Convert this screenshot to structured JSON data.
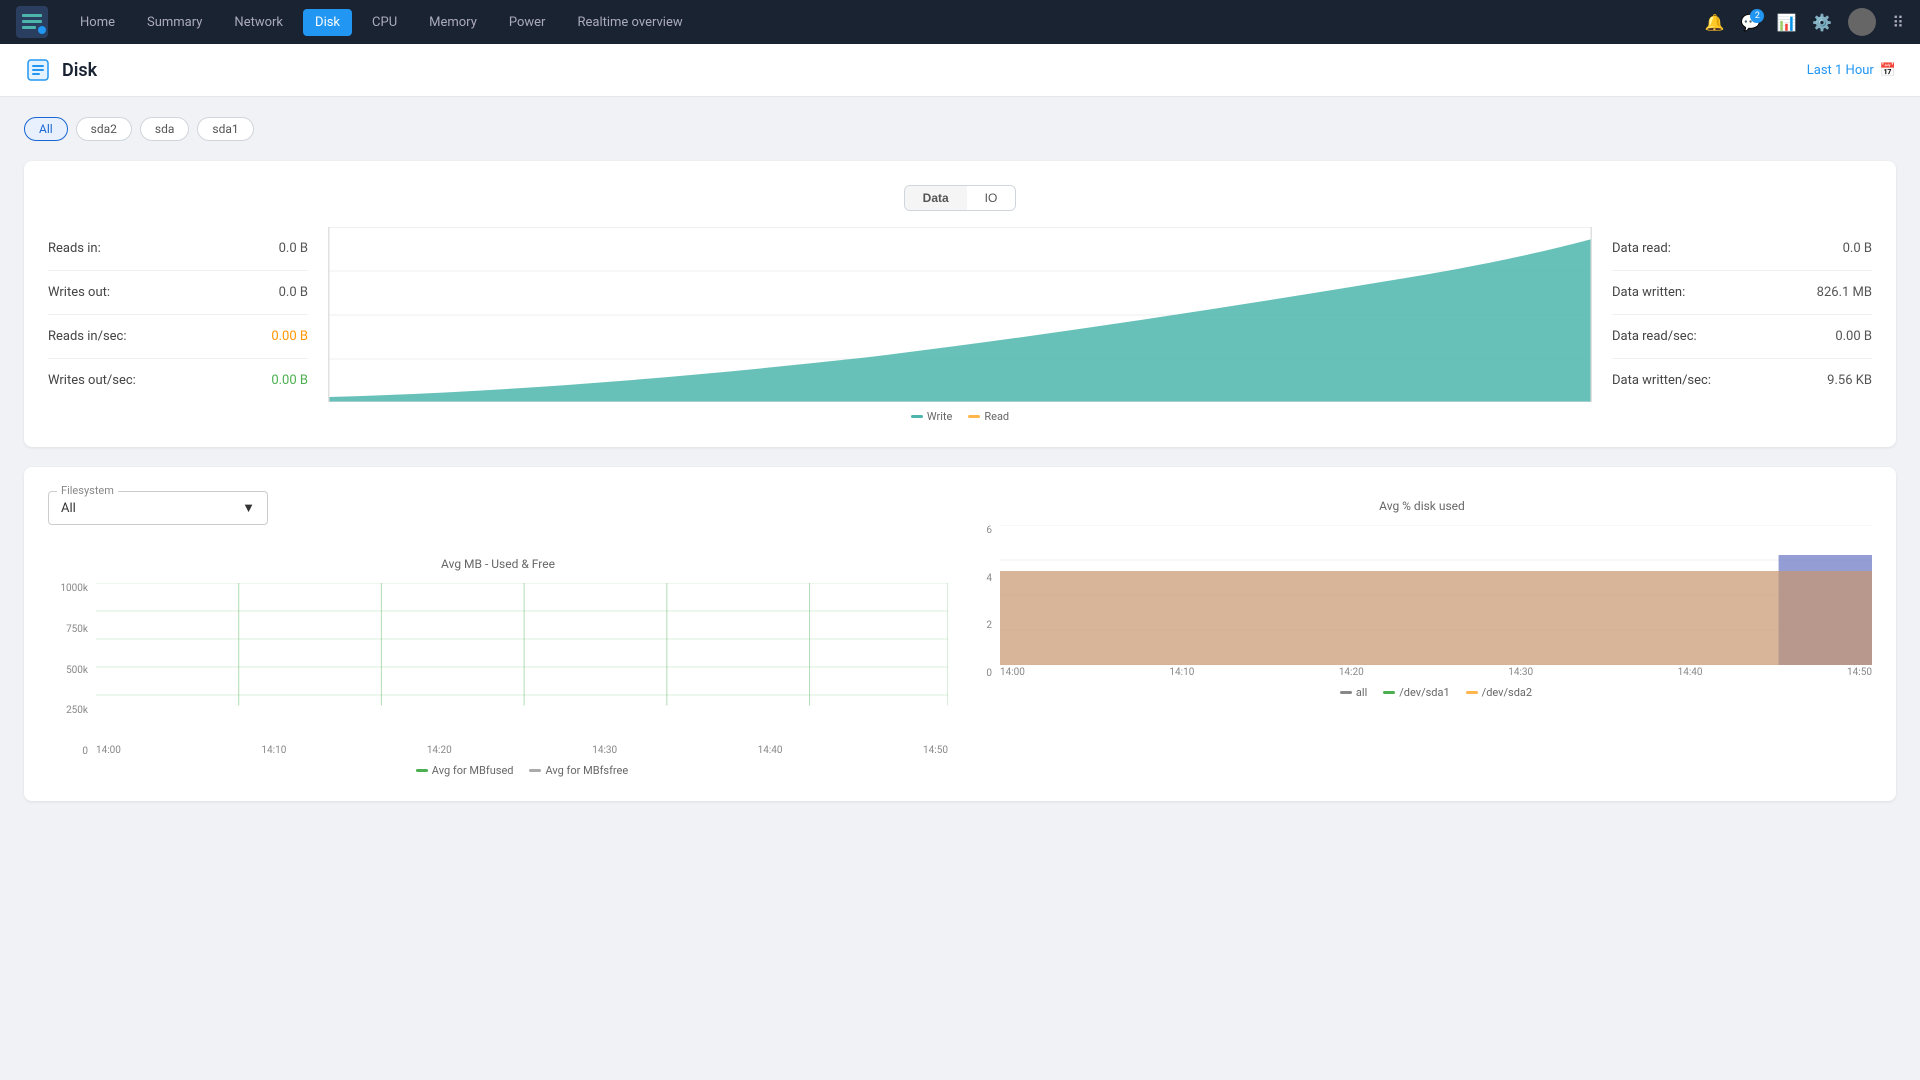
{
  "nav": {
    "links": [
      "Home",
      "Summary",
      "Network",
      "Disk",
      "CPU",
      "Memory",
      "Power",
      "Realtime overview"
    ],
    "active": "Disk",
    "badge_count": "2"
  },
  "page": {
    "title": "Disk",
    "time_filter": "Last 1 Hour"
  },
  "disk_tabs": [
    "All",
    "sda2",
    "sda",
    "sda1"
  ],
  "active_tab": "All",
  "toggle": {
    "options": [
      "Data",
      "IO"
    ],
    "active": "Data"
  },
  "stats_left": [
    {
      "label": "Reads in:",
      "value": "0.0 B",
      "class": ""
    },
    {
      "label": "Writes out:",
      "value": "0.0 B",
      "class": ""
    },
    {
      "label": "Reads in/sec:",
      "value": "0.00 B",
      "class": "orange"
    },
    {
      "label": "Writes out/sec:",
      "value": "0.00 B",
      "class": "green"
    }
  ],
  "stats_right": [
    {
      "label": "Data read:",
      "value": "0.0 B"
    },
    {
      "label": "Data written:",
      "value": "826.1 MB"
    },
    {
      "label": "Data read/sec:",
      "value": "0.00 B"
    },
    {
      "label": "Data written/sec:",
      "value": "9.56 KB"
    }
  ],
  "chart_legend": {
    "write_label": "Write",
    "read_label": "Read",
    "write_color": "#4db6ac",
    "read_color": "#ffb74d"
  },
  "filesystem": {
    "label": "Filesystem",
    "value": "All",
    "avg_mb_title": "Avg MB - Used & Free",
    "avg_disk_title": "Avg % disk used",
    "x_labels": [
      "14:00",
      "14:10",
      "14:20",
      "14:30",
      "14:40",
      "14:50"
    ],
    "y_labels_mb": [
      "1000k",
      "750k",
      "500k",
      "250k",
      "0"
    ],
    "y_labels_pct": [
      "6",
      "4",
      "2",
      "0"
    ],
    "legend_mb": [
      "Avg for MBfused",
      "Avg for MBfsfree"
    ],
    "legend_pct": [
      "all",
      "/dev/sda1",
      "/dev/sda2"
    ]
  }
}
